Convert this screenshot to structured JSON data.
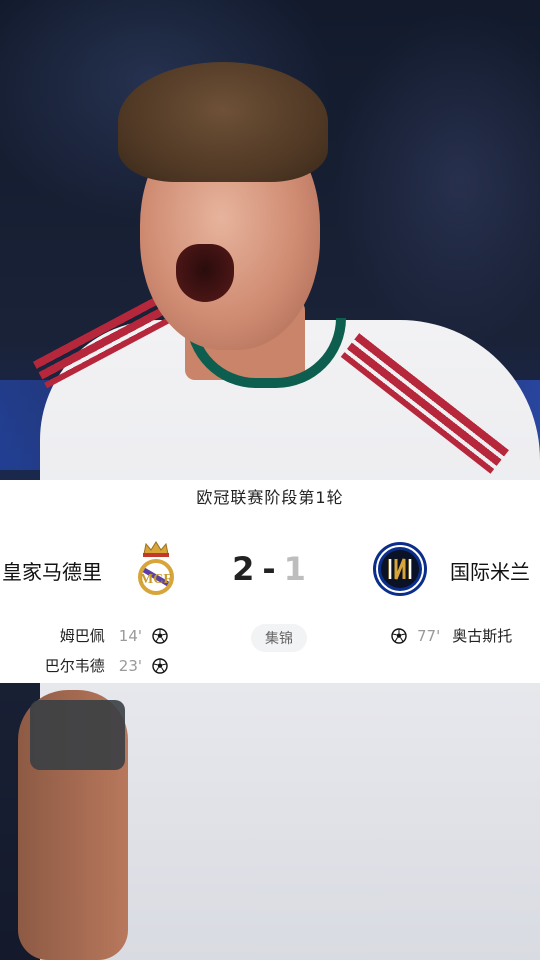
{
  "match": {
    "stage": "欧冠联赛阶段第1轮",
    "home": {
      "name": "皇家马德里",
      "crest": "real-madrid-crest",
      "score": "2"
    },
    "away": {
      "name": "国际米兰",
      "crest": "inter-milan-crest",
      "score": "1"
    },
    "score_separator": "-",
    "highlights_label": "集锦",
    "home_goals": [
      {
        "player": "姆巴佩",
        "minute": "14'"
      },
      {
        "player": "巴尔韦德",
        "minute": "23'"
      }
    ],
    "away_goals": [
      {
        "player": "奥古斯托",
        "minute": "77'"
      }
    ]
  },
  "colors": {
    "card_bg": "#ffffff",
    "inter_blue": "#0a2e8a",
    "madrid_gold": "#d8a53a",
    "muted": "#bdbdbd"
  },
  "icons": [
    "soccer-ball-icon",
    "real-madrid-crest",
    "inter-milan-crest"
  ]
}
